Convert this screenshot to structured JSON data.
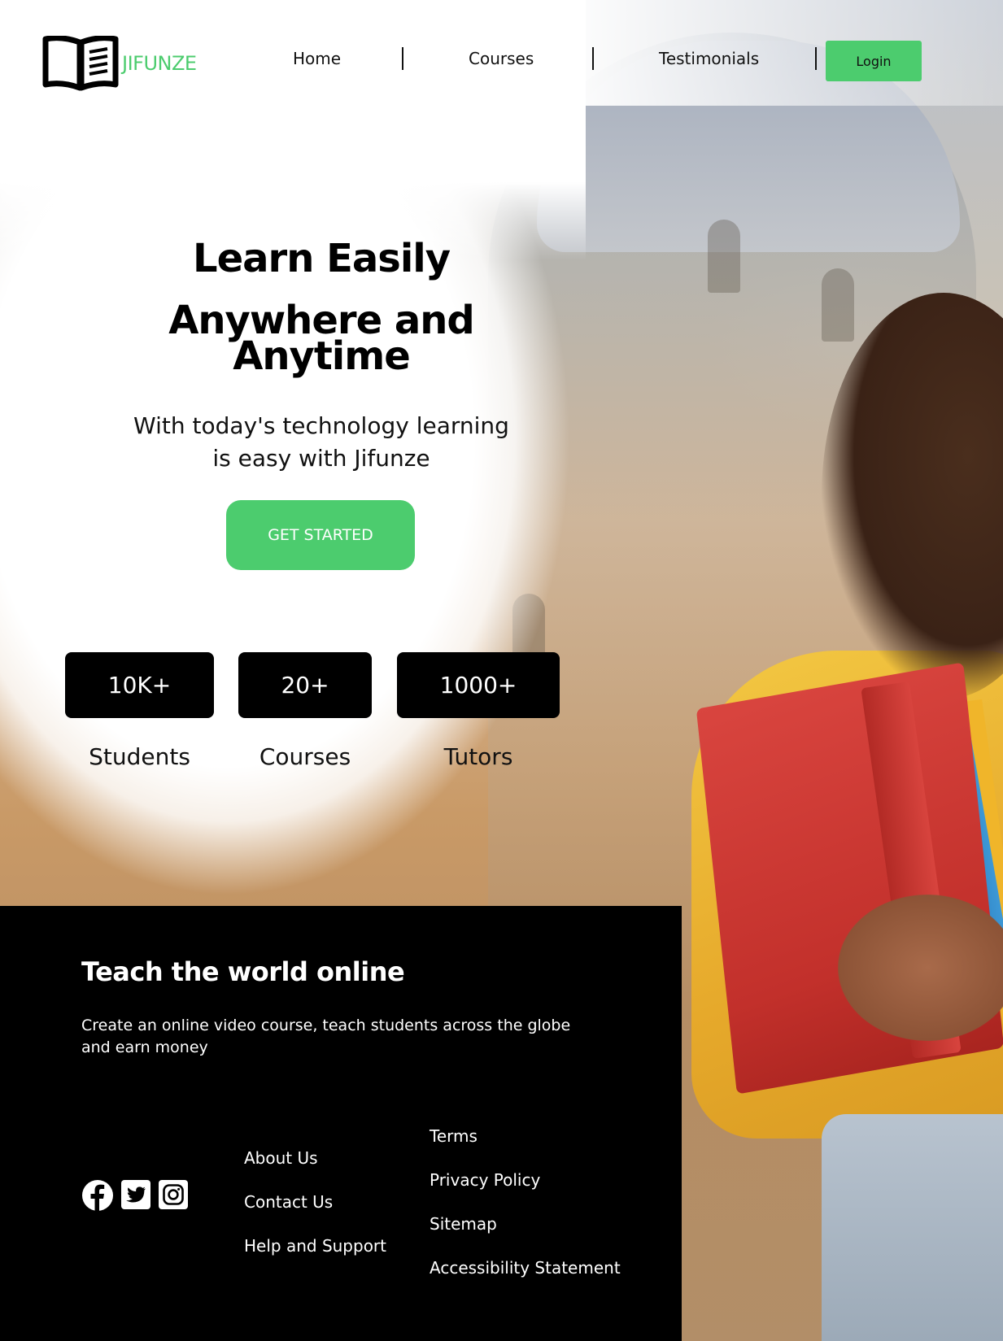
{
  "brand": {
    "name": "JIFUNZE",
    "logo_icon": "open-book-icon",
    "accent_color": "#4ccc6e"
  },
  "nav": {
    "items": [
      "Home",
      "Courses",
      "Testimonials"
    ],
    "login_label": "Login"
  },
  "hero": {
    "title_line1": "Learn Easily",
    "title_line2": "Anywhere and Anytime",
    "subtitle": "With today's technology learning is easy with Jifunze",
    "cta_label": "GET STARTED"
  },
  "stats": [
    {
      "value": "10K+",
      "label": "Students"
    },
    {
      "value": "20+",
      "label": "Courses"
    },
    {
      "value": "1000+",
      "label": "Tutors"
    }
  ],
  "footer": {
    "title": "Teach the world online",
    "subtitle": "Create an online video course, teach students across the globe and earn money",
    "social_icons": [
      "facebook-icon",
      "twitter-icon",
      "instagram-icon"
    ],
    "links_col1": [
      "About Us",
      "Contact Us",
      "Help and Support"
    ],
    "links_col2": [
      "Terms",
      "Privacy Policy",
      "Sitemap",
      "Accessibility Statement"
    ]
  }
}
